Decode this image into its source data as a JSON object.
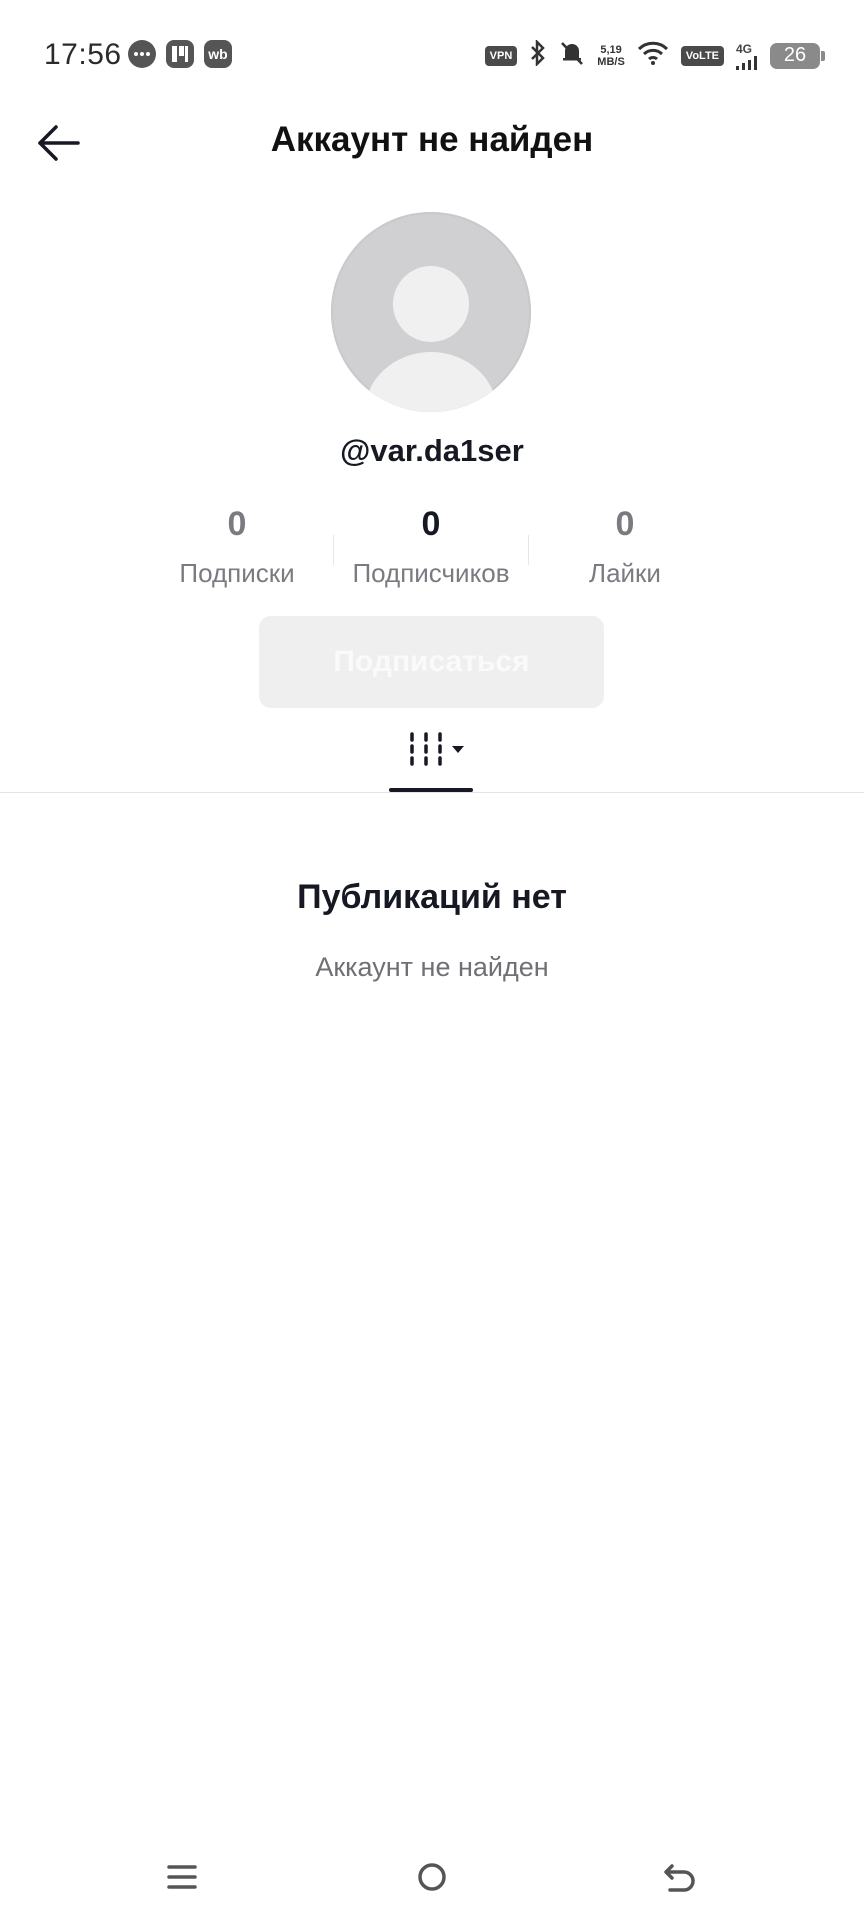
{
  "status_bar": {
    "time": "17:56",
    "left_icons": [
      "messages-icon",
      "p-app-icon",
      "wb-app-icon"
    ],
    "wb_label": "wb",
    "vpn_label": "VPN",
    "speed_value": "5,19",
    "speed_unit": "MB/S",
    "volte_label": "VoLTE",
    "network_label": "4G",
    "battery_level": "26"
  },
  "header": {
    "title": "Аккаунт не найден"
  },
  "profile": {
    "username": "@var.da1ser"
  },
  "stats": [
    {
      "value": "0",
      "label": "Подписки"
    },
    {
      "value": "0",
      "label": "Подписчиков"
    },
    {
      "value": "0",
      "label": "Лайки"
    }
  ],
  "follow_button": {
    "label": "Подписаться"
  },
  "empty_state": {
    "title": "Публикаций нет",
    "subtitle": "Аккаунт не найден"
  },
  "colors": {
    "text_primary": "#161823",
    "text_secondary": "#7a7b80",
    "button_disabled_bg": "#efeff0",
    "avatar_bg": "#d0d0d2"
  }
}
